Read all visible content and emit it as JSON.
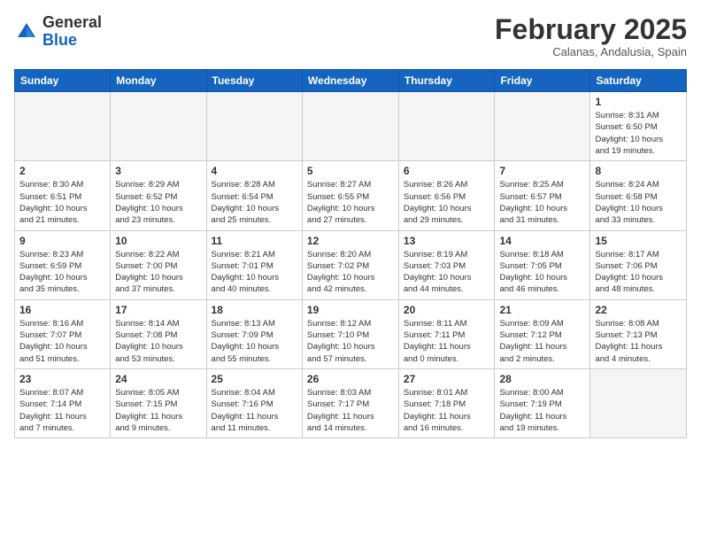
{
  "header": {
    "logo_general": "General",
    "logo_blue": "Blue",
    "month_title": "February 2025",
    "location": "Calanas, Andalusia, Spain"
  },
  "weekdays": [
    "Sunday",
    "Monday",
    "Tuesday",
    "Wednesday",
    "Thursday",
    "Friday",
    "Saturday"
  ],
  "weeks": [
    [
      {
        "day": "",
        "info": ""
      },
      {
        "day": "",
        "info": ""
      },
      {
        "day": "",
        "info": ""
      },
      {
        "day": "",
        "info": ""
      },
      {
        "day": "",
        "info": ""
      },
      {
        "day": "",
        "info": ""
      },
      {
        "day": "1",
        "info": "Sunrise: 8:31 AM\nSunset: 6:50 PM\nDaylight: 10 hours\nand 19 minutes."
      }
    ],
    [
      {
        "day": "2",
        "info": "Sunrise: 8:30 AM\nSunset: 6:51 PM\nDaylight: 10 hours\nand 21 minutes."
      },
      {
        "day": "3",
        "info": "Sunrise: 8:29 AM\nSunset: 6:52 PM\nDaylight: 10 hours\nand 23 minutes."
      },
      {
        "day": "4",
        "info": "Sunrise: 8:28 AM\nSunset: 6:54 PM\nDaylight: 10 hours\nand 25 minutes."
      },
      {
        "day": "5",
        "info": "Sunrise: 8:27 AM\nSunset: 6:55 PM\nDaylight: 10 hours\nand 27 minutes."
      },
      {
        "day": "6",
        "info": "Sunrise: 8:26 AM\nSunset: 6:56 PM\nDaylight: 10 hours\nand 29 minutes."
      },
      {
        "day": "7",
        "info": "Sunrise: 8:25 AM\nSunset: 6:57 PM\nDaylight: 10 hours\nand 31 minutes."
      },
      {
        "day": "8",
        "info": "Sunrise: 8:24 AM\nSunset: 6:58 PM\nDaylight: 10 hours\nand 33 minutes."
      }
    ],
    [
      {
        "day": "9",
        "info": "Sunrise: 8:23 AM\nSunset: 6:59 PM\nDaylight: 10 hours\nand 35 minutes."
      },
      {
        "day": "10",
        "info": "Sunrise: 8:22 AM\nSunset: 7:00 PM\nDaylight: 10 hours\nand 37 minutes."
      },
      {
        "day": "11",
        "info": "Sunrise: 8:21 AM\nSunset: 7:01 PM\nDaylight: 10 hours\nand 40 minutes."
      },
      {
        "day": "12",
        "info": "Sunrise: 8:20 AM\nSunset: 7:02 PM\nDaylight: 10 hours\nand 42 minutes."
      },
      {
        "day": "13",
        "info": "Sunrise: 8:19 AM\nSunset: 7:03 PM\nDaylight: 10 hours\nand 44 minutes."
      },
      {
        "day": "14",
        "info": "Sunrise: 8:18 AM\nSunset: 7:05 PM\nDaylight: 10 hours\nand 46 minutes."
      },
      {
        "day": "15",
        "info": "Sunrise: 8:17 AM\nSunset: 7:06 PM\nDaylight: 10 hours\nand 48 minutes."
      }
    ],
    [
      {
        "day": "16",
        "info": "Sunrise: 8:16 AM\nSunset: 7:07 PM\nDaylight: 10 hours\nand 51 minutes."
      },
      {
        "day": "17",
        "info": "Sunrise: 8:14 AM\nSunset: 7:08 PM\nDaylight: 10 hours\nand 53 minutes."
      },
      {
        "day": "18",
        "info": "Sunrise: 8:13 AM\nSunset: 7:09 PM\nDaylight: 10 hours\nand 55 minutes."
      },
      {
        "day": "19",
        "info": "Sunrise: 8:12 AM\nSunset: 7:10 PM\nDaylight: 10 hours\nand 57 minutes."
      },
      {
        "day": "20",
        "info": "Sunrise: 8:11 AM\nSunset: 7:11 PM\nDaylight: 11 hours\nand 0 minutes."
      },
      {
        "day": "21",
        "info": "Sunrise: 8:09 AM\nSunset: 7:12 PM\nDaylight: 11 hours\nand 2 minutes."
      },
      {
        "day": "22",
        "info": "Sunrise: 8:08 AM\nSunset: 7:13 PM\nDaylight: 11 hours\nand 4 minutes."
      }
    ],
    [
      {
        "day": "23",
        "info": "Sunrise: 8:07 AM\nSunset: 7:14 PM\nDaylight: 11 hours\nand 7 minutes."
      },
      {
        "day": "24",
        "info": "Sunrise: 8:05 AM\nSunset: 7:15 PM\nDaylight: 11 hours\nand 9 minutes."
      },
      {
        "day": "25",
        "info": "Sunrise: 8:04 AM\nSunset: 7:16 PM\nDaylight: 11 hours\nand 11 minutes."
      },
      {
        "day": "26",
        "info": "Sunrise: 8:03 AM\nSunset: 7:17 PM\nDaylight: 11 hours\nand 14 minutes."
      },
      {
        "day": "27",
        "info": "Sunrise: 8:01 AM\nSunset: 7:18 PM\nDaylight: 11 hours\nand 16 minutes."
      },
      {
        "day": "28",
        "info": "Sunrise: 8:00 AM\nSunset: 7:19 PM\nDaylight: 11 hours\nand 19 minutes."
      },
      {
        "day": "",
        "info": ""
      }
    ]
  ]
}
